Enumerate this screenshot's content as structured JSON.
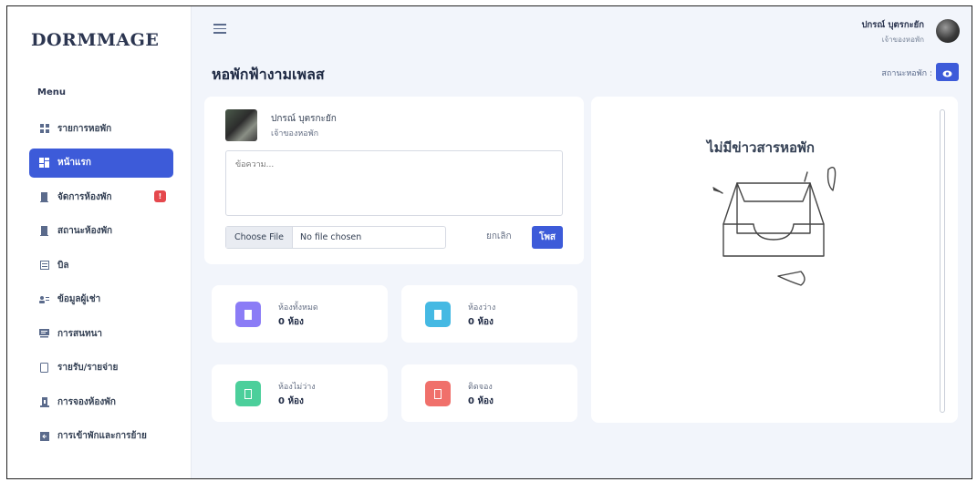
{
  "app": {
    "logo": "DORMMAGE"
  },
  "sidebar": {
    "menu_title": "Menu",
    "items": [
      {
        "label": "รายการหอพัก",
        "icon": "grid-icon",
        "active": false
      },
      {
        "label": "หน้าแรก",
        "icon": "dashboard-icon",
        "active": true
      },
      {
        "label": "จัดการห้องพัก",
        "icon": "door-icon",
        "active": false,
        "badge": "!"
      },
      {
        "label": "สถานะห้องพัก",
        "icon": "door-icon",
        "active": false
      },
      {
        "label": "บิล",
        "icon": "bill-icon",
        "active": false
      },
      {
        "label": "ข้อมูลผู้เช่า",
        "icon": "users-icon",
        "active": false
      },
      {
        "label": "การสนทนา",
        "icon": "chat-icon",
        "active": false
      },
      {
        "label": "รายรับ/รายจ่าย",
        "icon": "wallet-icon",
        "active": false
      },
      {
        "label": "การจองห้องพัก",
        "icon": "booking-icon",
        "active": false
      },
      {
        "label": "การเข้าพักและการย้าย",
        "icon": "move-icon",
        "active": false
      }
    ]
  },
  "header": {
    "user_name": "ปกรณ์ บุตรกะยัก",
    "user_role": "เจ้าของหอพัก",
    "page_title": "หอพักฟ้างามเพลส",
    "status_label": "สถานะหอพัก :"
  },
  "post": {
    "author_name": "ปกรณ์ บุตรกะยัก",
    "author_role": "เจ้าของหอพัก",
    "placeholder": "ข้อความ...",
    "file_button": "Choose File",
    "file_status": "No file chosen",
    "cancel_label": "ยกเลิก",
    "submit_label": "โพส"
  },
  "stats": [
    {
      "label": "ห้องทั้งหมด",
      "value": "0 ห้อง",
      "color": "#8b7cf6"
    },
    {
      "label": "ห้องว่าง",
      "value": "0 ห้อง",
      "color": "#45b9e3"
    },
    {
      "label": "ห้องไม่ว่าง",
      "value": "0 ห้อง",
      "color": "#4ccf9b"
    },
    {
      "label": "ติดจอง",
      "value": "0 ห้อง",
      "color": "#f0706b"
    }
  ],
  "news": {
    "empty_title": "ไม่มีข่าวสารหอพัก"
  },
  "colors": {
    "accent": "#3d5bd9",
    "badge": "#e5484d"
  }
}
